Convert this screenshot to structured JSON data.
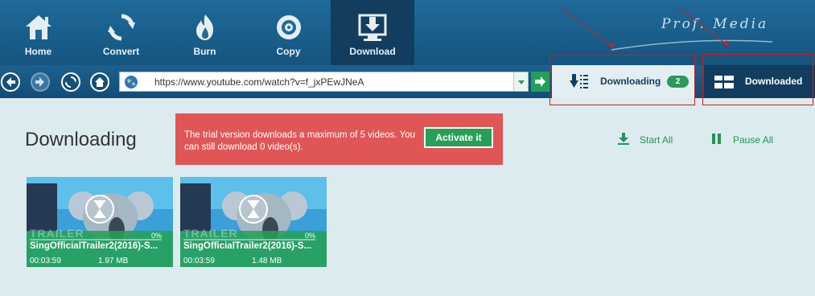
{
  "toolbar": {
    "items": [
      {
        "label": "Home",
        "icon": "home-icon"
      },
      {
        "label": "Convert",
        "icon": "convert-icon"
      },
      {
        "label": "Burn",
        "icon": "burn-icon"
      },
      {
        "label": "Copy",
        "icon": "copy-icon"
      },
      {
        "label": "Download",
        "icon": "download-icon",
        "active": true
      }
    ],
    "brand": "Prof. Media"
  },
  "navigation": {
    "url": "https://www.youtube.com/watch?v=f_jxPEwJNeA"
  },
  "download_tabs": {
    "downloading": {
      "label": "Downloading",
      "count": "2"
    },
    "downloaded": {
      "label": "Downloaded"
    }
  },
  "main": {
    "title": "Downloading",
    "trial_message": "The trial version downloads a maximum of 5 videos. You can still download 0 video(s).",
    "activate_label": "Activate it",
    "start_all_label": "Start All",
    "pause_all_label": "Pause All"
  },
  "videos": [
    {
      "title": "SingOfficialTrailer2(2016)-S...",
      "duration": "00:03:59",
      "size": "1.97 MB",
      "progress": "0%",
      "overlay": "TRAILER"
    },
    {
      "title": "SingOfficialTrailer2(2016)-S...",
      "duration": "00:03:59",
      "size": "1.48 MB",
      "progress": "0%",
      "overlay": "TRAILER"
    }
  ],
  "colors": {
    "toolbar": "#1f6a99",
    "active_tab": "#123d5e",
    "accent_green": "#26a057",
    "trial_red": "#e05656",
    "background": "#dcebee",
    "annotation_red": "#cc1f1f"
  }
}
